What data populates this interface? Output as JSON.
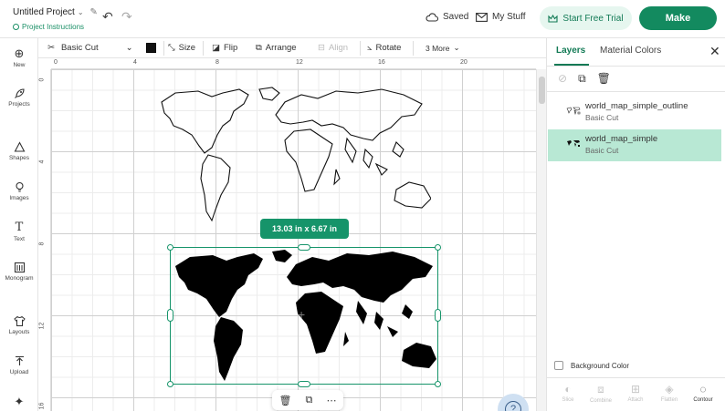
{
  "header": {
    "project_title": "Untitled Project",
    "project_instructions": "Project Instructions",
    "saved_label": "Saved",
    "my_stuff_label": "My Stuff",
    "free_trial_label": "Start Free Trial",
    "make_label": "Make"
  },
  "left_sidebar": {
    "items": [
      {
        "label": "New",
        "icon": "plus-circle-icon"
      },
      {
        "label": "Projects",
        "icon": "rocket-icon"
      },
      {
        "label": "Shapes",
        "icon": "shapes-icon"
      },
      {
        "label": "Images",
        "icon": "lightbulb-icon"
      },
      {
        "label": "Text",
        "icon": "text-icon"
      },
      {
        "label": "Monogram",
        "icon": "monogram-icon"
      },
      {
        "label": "Layouts",
        "icon": "shirt-icon"
      },
      {
        "label": "Upload",
        "icon": "upload-icon"
      }
    ]
  },
  "toolbar": {
    "operation": "Basic Cut",
    "color": "#111111",
    "size_label": "Size",
    "flip_label": "Flip",
    "arrange_label": "Arrange",
    "align_label": "Align",
    "rotate_label": "Rotate",
    "more_label": "3 More"
  },
  "canvas": {
    "ruler_top_labels": [
      "0",
      "4",
      "8",
      "12",
      "16",
      "20"
    ],
    "ruler_left_labels": [
      "0",
      "4",
      "8",
      "12",
      "16"
    ],
    "size_badge": "13.03  in x 6.67  in",
    "help_label": "?"
  },
  "layers_panel": {
    "tabs": {
      "layers": "Layers",
      "material_colors": "Material Colors"
    },
    "layers": [
      {
        "name": "world_map_simple_outline",
        "operation": "Basic Cut",
        "selected": false
      },
      {
        "name": "world_map_simple",
        "operation": "Basic Cut",
        "selected": true
      }
    ],
    "background_color_label": "Background Color",
    "bottom_tools": [
      {
        "label": "Slice",
        "icon": "slice-icon",
        "enabled": false
      },
      {
        "label": "Combine",
        "icon": "combine-icon",
        "enabled": false
      },
      {
        "label": "Attach",
        "icon": "attach-icon",
        "enabled": false
      },
      {
        "label": "Flatten",
        "icon": "flatten-icon",
        "enabled": false
      },
      {
        "label": "Contour",
        "icon": "contour-icon",
        "enabled": true
      }
    ]
  },
  "colors": {
    "accent": "#138a5f",
    "selection": "#16946a",
    "selected_layer_bg": "#b8e8d4"
  }
}
